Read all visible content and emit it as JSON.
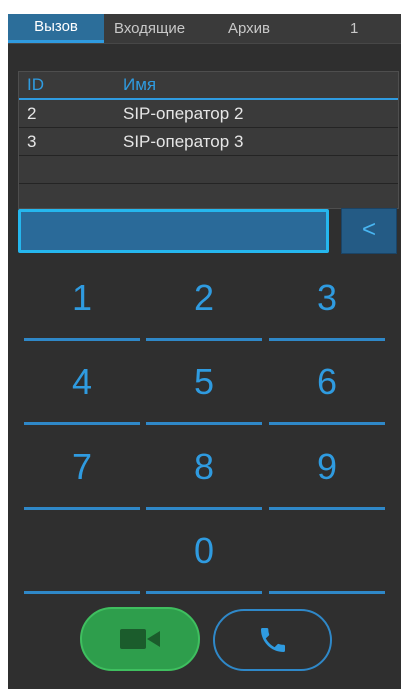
{
  "tabs": [
    {
      "label": "Вызов",
      "active": true
    },
    {
      "label": "Входящие",
      "active": false
    },
    {
      "label": "Архив",
      "active": false
    },
    {
      "label": "1",
      "active": false
    }
  ],
  "table": {
    "headers": {
      "id": "ID",
      "name": "Имя"
    },
    "rows": [
      {
        "id": "2",
        "name": "SIP-оператор 2"
      },
      {
        "id": "3",
        "name": "SIP-оператор 3"
      }
    ]
  },
  "dialer": {
    "input_value": "",
    "backspace_label": "<"
  },
  "keypad": {
    "keys": [
      "1",
      "2",
      "3",
      "4",
      "5",
      "6",
      "7",
      "8",
      "9",
      "0"
    ]
  },
  "call_buttons": {
    "video_icon": "video-camera-icon",
    "voice_icon": "phone-handset-icon"
  },
  "colors": {
    "accent": "#2f9be0",
    "panel_bg": "#2f2f2f",
    "video_green": "#2e9e4c"
  }
}
